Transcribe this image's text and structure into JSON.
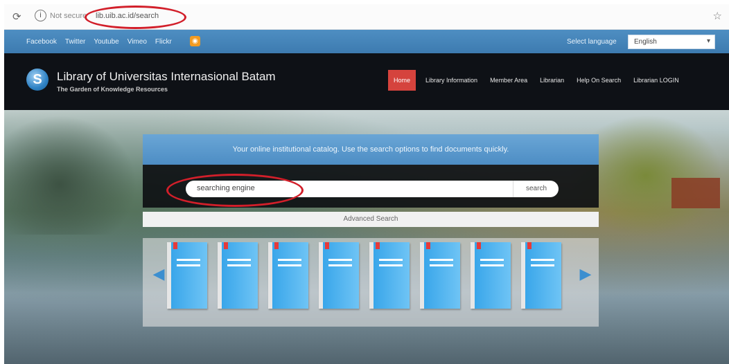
{
  "browser": {
    "site_label": "Not secure",
    "url": "lib.uib.ac.id/search",
    "reload_icon": "reload-icon",
    "info_icon": "info-icon",
    "star_icon": "star-icon"
  },
  "topbar": {
    "social": [
      "Facebook",
      "Twitter",
      "Youtube",
      "Vimeo",
      "Flickr"
    ],
    "language_label": "Select language",
    "language_value": "English"
  },
  "header": {
    "title": "Library of Universitas Internasional Batam",
    "subtitle": "The Garden of Knowledge Resources",
    "nav": [
      "Home",
      "Library Information",
      "Member Area",
      "Librarian",
      "Help On Search",
      "Librarian LOGIN"
    ]
  },
  "search": {
    "intro": "Your online institutional catalog. Use the search options to find documents quickly.",
    "query": "searching engine",
    "button": "search",
    "advanced": "Advanced Search"
  },
  "carousel": {
    "book_count": 8,
    "prev_icon": "arrow-left-icon",
    "next_icon": "arrow-right-icon"
  },
  "colors": {
    "topbar": "#4e8ec2",
    "header": "#0e1116",
    "home_active": "#d5433d",
    "highlight_circle": "#d21f2a",
    "book": "#39a6ea"
  }
}
